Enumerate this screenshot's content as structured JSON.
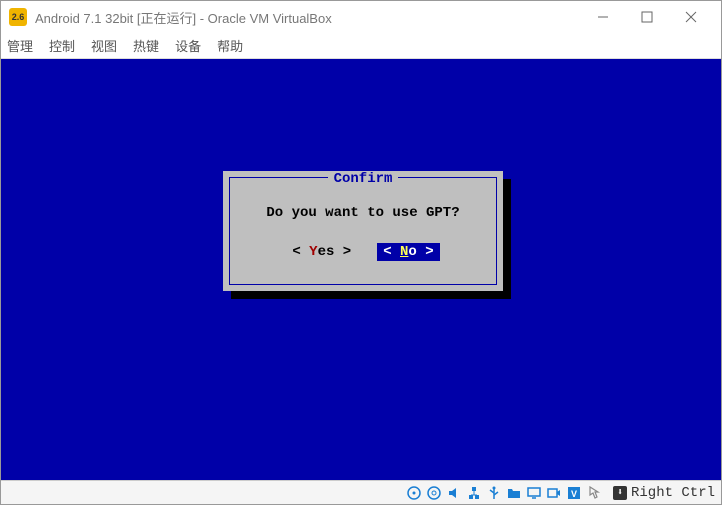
{
  "titlebar": {
    "icon_text": "2.6",
    "title": "Android 7.1 32bit [正在运行] - Oracle VM VirtualBox"
  },
  "menu": {
    "items": [
      "管理",
      "控制",
      "视图",
      "热键",
      "设备",
      "帮助"
    ]
  },
  "dialog": {
    "title": "Confirm",
    "message": "Do you want to use GPT?",
    "yes_hot": "Y",
    "yes_rest": "es",
    "no_hot": "N",
    "no_rest": "o"
  },
  "statusbar": {
    "hostkey": "Right Ctrl"
  }
}
